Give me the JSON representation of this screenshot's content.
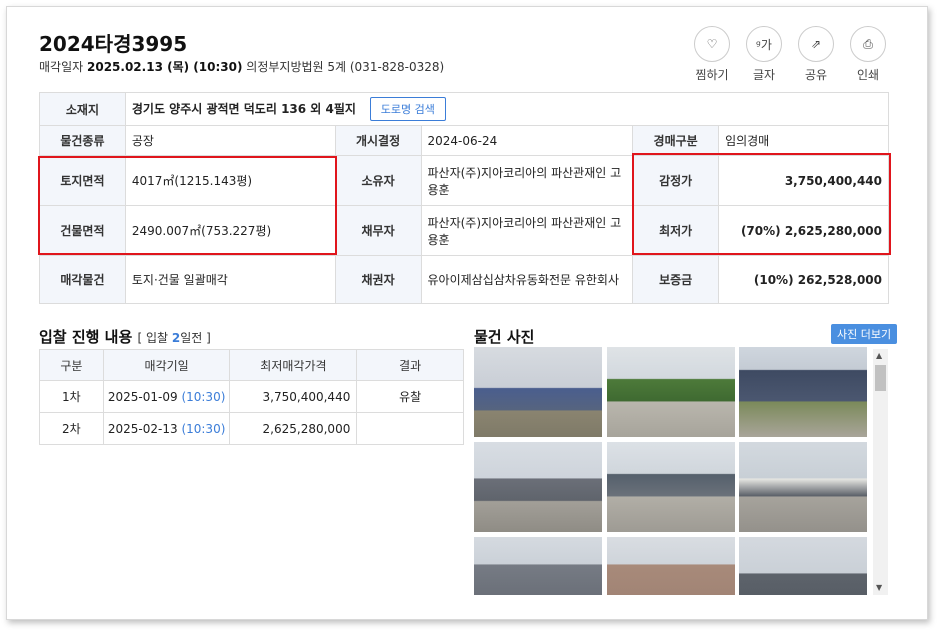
{
  "header": {
    "case_no": "2024타경3995",
    "sale_date_label": "매각일자",
    "sale_date": "2025.02.13 (목) (10:30)",
    "court": "의정부지방법원 5계 (031-828-0328)"
  },
  "toolbar": [
    {
      "icon": "heart-icon",
      "glyph": "♡",
      "label": "찜하기"
    },
    {
      "icon": "font-size-icon",
      "glyph": "ᵍ가",
      "label": "글자"
    },
    {
      "icon": "share-icon",
      "glyph": "⇗",
      "label": "공유"
    },
    {
      "icon": "print-icon",
      "glyph": "⎙",
      "label": "인쇄"
    }
  ],
  "info": {
    "location_label": "소재지",
    "location": "경기도 양주시 광적면 덕도리 136 외 4필지",
    "road_btn": "도로명 검색",
    "type_label": "물건종류",
    "type": "공장",
    "start_label": "개시결정",
    "start": "2024-06-24",
    "auction_kind_label": "경매구분",
    "auction_kind": "임의경매",
    "land_label": "토지면적",
    "land": "4017㎡(1215.143평)",
    "owner_label": "소유자",
    "owner": "파산자(주)지아코리아의 파산관재인 고용훈",
    "appraisal_label": "감정가",
    "appraisal": "3,750,400,440",
    "building_label": "건물면적",
    "building": "2490.007㎡(753.227평)",
    "debtor_label": "채무자",
    "debtor": "파산자(주)지아코리아의 파산관재인 고용훈",
    "min_label": "최저가",
    "min_pct": "(70%)",
    "min": "2,625,280,000",
    "sale_item_label": "매각물건",
    "sale_item": "토지·건물 일괄매각",
    "creditor_label": "채권자",
    "creditor": "유아이제삼십삼차유동화전문 유한회사",
    "deposit_label": "보증금",
    "deposit": "(10%) 262,528,000"
  },
  "bid": {
    "title": "입찰 진행 내용",
    "dday_open": "[ 입찰 ",
    "dday_num": "2",
    "dday_close": "일전 ]",
    "headers": [
      "구분",
      "매각기일",
      "최저매각가격",
      "결과"
    ],
    "rows": [
      {
        "round": "1차",
        "date": "2025-01-09",
        "time": "(10:30)",
        "price": "3,750,400,440",
        "result": "유찰"
      },
      {
        "round": "2차",
        "date": "2025-02-13",
        "time": "(10:30)",
        "price": "2,625,280,000",
        "result": ""
      }
    ]
  },
  "photos": {
    "title": "물건 사진",
    "more_btn": "사진 더보기"
  },
  "colors": {
    "accent": "#3b7dd8",
    "highlight_border": "#e0151c",
    "header_bg": "#f3f6fb"
  }
}
